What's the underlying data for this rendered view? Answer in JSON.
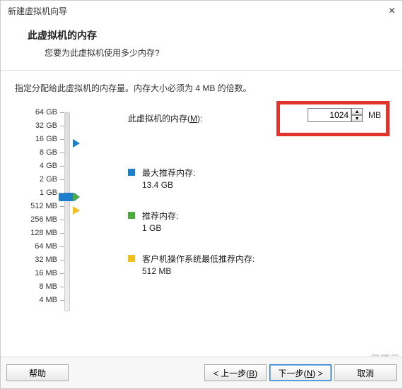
{
  "titlebar": {
    "title": "新建虚拟机向导"
  },
  "header": {
    "title": "此虚拟机的内存",
    "sub": "您要为此虚拟机使用多少内存?"
  },
  "instruction": "指定分配给此虚拟机的内存量。内存大小必须为 4 MB 的倍数。",
  "memory": {
    "label_pre": "此虚拟机的内存(",
    "label_key": "M",
    "label_post": "):",
    "value": "1024",
    "unit": "MB"
  },
  "scale": [
    "64 GB",
    "32 GB",
    "16 GB",
    "8 GB",
    "4 GB",
    "2 GB",
    "1 GB",
    "512 MB",
    "256 MB",
    "128 MB",
    "64 MB",
    "32 MB",
    "16 MB",
    "8 MB",
    "4 MB"
  ],
  "recommend": {
    "max": {
      "label": "最大推荐内存:",
      "value": "13.4 GB",
      "color": "#1b7fcc"
    },
    "rec": {
      "label": "推荐内存:",
      "value": "1 GB",
      "color": "#4cae3a"
    },
    "guest": {
      "label": "客户机操作系统最低推荐内存:",
      "value": "512 MB",
      "color": "#f2c016"
    }
  },
  "footer": {
    "help": "帮助",
    "back_pre": "< 上一步(",
    "back_key": "B",
    "back_post": ")",
    "next_pre": "下一步(",
    "next_key": "N",
    "next_post": ") >",
    "cancel": "取消"
  },
  "watermark": "亿速云"
}
